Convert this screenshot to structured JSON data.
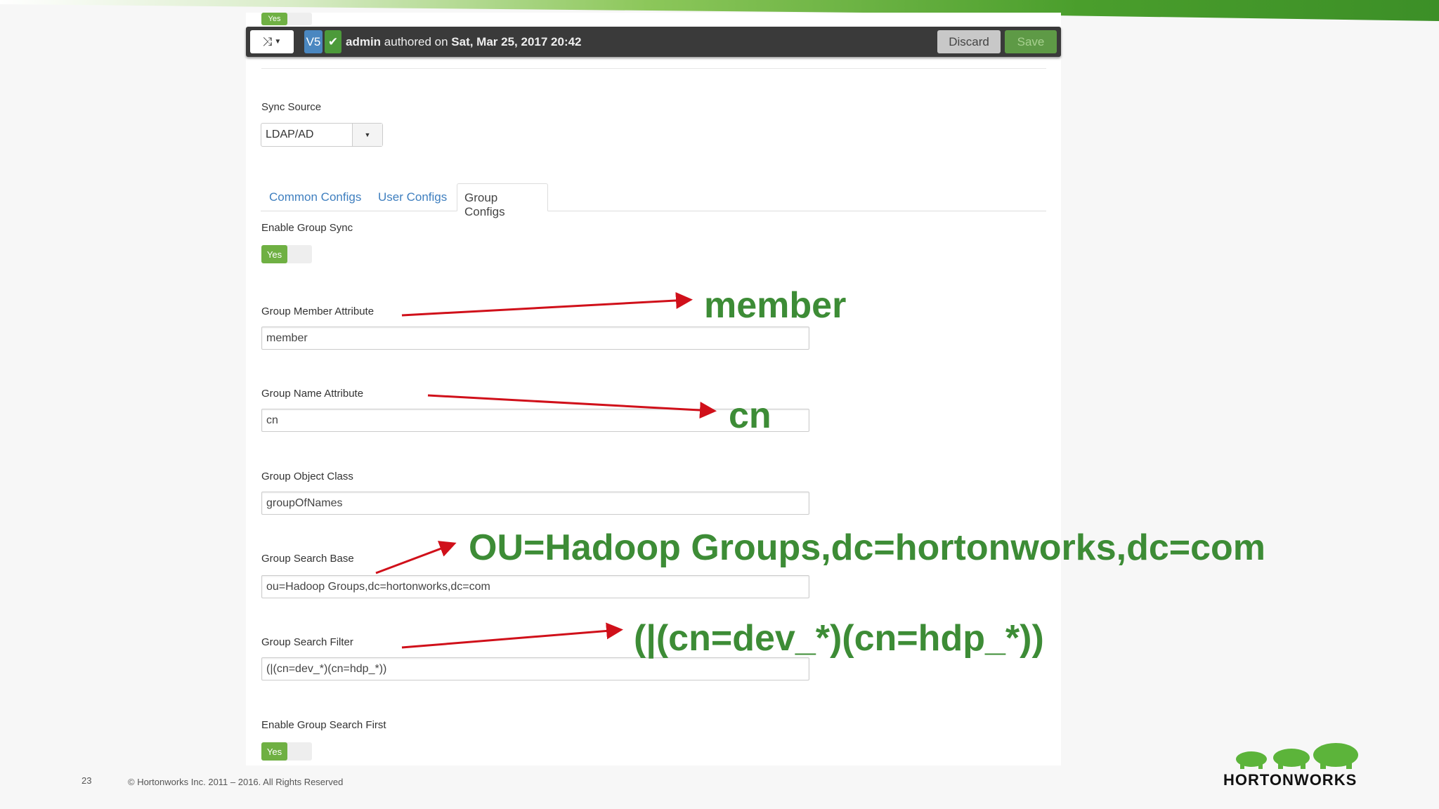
{
  "toolbar": {
    "version_badge": "V5",
    "author": "admin",
    "authored_text": "authored on",
    "date": "Sat, Mar 25, 2017 20:42",
    "discard_label": "Discard",
    "save_label": "Save",
    "top_toggle_label": "Yes"
  },
  "sync_source": {
    "label": "Sync Source",
    "value": "LDAP/AD"
  },
  "tabs": [
    {
      "label": "Common Configs",
      "active": false
    },
    {
      "label": "User Configs",
      "active": false
    },
    {
      "label": "Group Configs",
      "active": true
    }
  ],
  "form": {
    "enable_group_sync": {
      "label": "Enable Group Sync",
      "value": "Yes"
    },
    "group_member_attribute": {
      "label": "Group Member Attribute",
      "value": "member"
    },
    "group_name_attribute": {
      "label": "Group Name Attribute",
      "value": "cn"
    },
    "group_object_class": {
      "label": "Group Object Class",
      "value": "groupOfNames"
    },
    "group_search_base": {
      "label": "Group Search Base",
      "value": "ou=Hadoop Groups,dc=hortonworks,dc=com"
    },
    "group_search_filter": {
      "label": "Group Search Filter",
      "value": "(|(cn=dev_*)(cn=hdp_*))"
    },
    "enable_group_search_first": {
      "label": "Enable Group Search First",
      "value": "Yes"
    }
  },
  "annotations": {
    "member": "member",
    "cn": "cn",
    "search_base": "OU=Hadoop Groups,dc=hortonworks,dc=com",
    "search_filter": "(|(cn=dev_*)(cn=hdp_*))"
  },
  "footer": {
    "slide_number": "23",
    "copyright": "© Hortonworks Inc. 2011 – 2016. All Rights Reserved",
    "logo_text": "HORTONWORKS"
  },
  "colors": {
    "annotation": "#3d8c36",
    "arrow": "#d0101a",
    "toggle_on": "#6fb043",
    "link": "#337ab7"
  }
}
